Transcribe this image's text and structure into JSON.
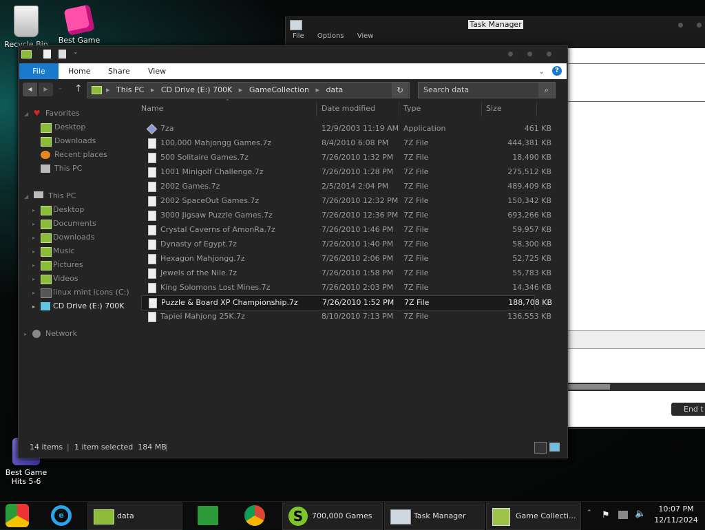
{
  "desktop": {
    "icons": [
      {
        "label": "Recycle Bin"
      },
      {
        "label": "Best Game"
      },
      {
        "label": "Best Game Hits 5-6"
      }
    ]
  },
  "task_manager": {
    "title": "Task Manager",
    "menu": [
      "File",
      "Options",
      "View"
    ],
    "end_task": "End t"
  },
  "explorer": {
    "ribbon_tabs": {
      "file": "File",
      "home": "Home",
      "share": "Share",
      "view": "View"
    },
    "breadcrumb": [
      "This PC",
      "CD Drive (E:) 700K",
      "GameCollection",
      "data"
    ],
    "search_placeholder": "Search data",
    "columns": {
      "name": "Name",
      "date": "Date modified",
      "type": "Type",
      "size": "Size"
    },
    "nav": {
      "favorites": "Favorites",
      "fav_items": [
        "Desktop",
        "Downloads",
        "Recent places",
        "This PC"
      ],
      "this_pc": "This PC",
      "pc_items": [
        "Desktop",
        "Documents",
        "Downloads",
        "Music",
        "Pictures",
        "Videos",
        "linux mint icons (C:)",
        "CD Drive (E:) 700K"
      ],
      "network": "Network"
    },
    "files": [
      {
        "name": "7za",
        "date": "12/9/2003 11:19 AM",
        "type": "Application",
        "size": "461 KB"
      },
      {
        "name": "100,000 Mahjongg Games.7z",
        "date": "8/4/2010 6:08 PM",
        "type": "7Z File",
        "size": "444,381 KB"
      },
      {
        "name": "500 Solitaire Games.7z",
        "date": "7/26/2010 1:32 PM",
        "type": "7Z File",
        "size": "18,490 KB"
      },
      {
        "name": "1001 Minigolf Challenge.7z",
        "date": "7/26/2010 1:28 PM",
        "type": "7Z File",
        "size": "275,512 KB"
      },
      {
        "name": "2002 Games.7z",
        "date": "2/5/2014 2:04 PM",
        "type": "7Z File",
        "size": "489,409 KB"
      },
      {
        "name": "2002 SpaceOut Games.7z",
        "date": "7/26/2010 12:32 PM",
        "type": "7Z File",
        "size": "150,342 KB"
      },
      {
        "name": "3000 Jigsaw Puzzle Games.7z",
        "date": "7/26/2010 12:36 PM",
        "type": "7Z File",
        "size": "693,266 KB"
      },
      {
        "name": "Crystal Caverns of AmonRa.7z",
        "date": "7/26/2010 1:46 PM",
        "type": "7Z File",
        "size": "59,957 KB"
      },
      {
        "name": "Dynasty of Egypt.7z",
        "date": "7/26/2010 1:40 PM",
        "type": "7Z File",
        "size": "58,300 KB"
      },
      {
        "name": "Hexagon Mahjongg.7z",
        "date": "7/26/2010 2:06 PM",
        "type": "7Z File",
        "size": "52,725 KB"
      },
      {
        "name": "Jewels of the Nile.7z",
        "date": "7/26/2010 1:58 PM",
        "type": "7Z File",
        "size": "55,783 KB"
      },
      {
        "name": "King Solomons Lost Mines.7z",
        "date": "7/26/2010 2:03 PM",
        "type": "7Z File",
        "size": "14,346 KB"
      },
      {
        "name": "Puzzle & Board XP Championship.7z",
        "date": "7/26/2010 1:52 PM",
        "type": "7Z File",
        "size": "188,708 KB"
      },
      {
        "name": "Tapiei Mahjong 25K.7z",
        "date": "8/10/2010 7:13 PM",
        "type": "7Z File",
        "size": "136,553 KB"
      }
    ],
    "status": {
      "count": "14 items",
      "selected": "1 item selected  184 MB"
    }
  },
  "taskbar": {
    "buttons": [
      "data",
      "700,000 Games",
      "Task Manager",
      "Game Collecti..."
    ],
    "clock": {
      "time": "10:07 PM",
      "date": "12/11/2024"
    }
  }
}
